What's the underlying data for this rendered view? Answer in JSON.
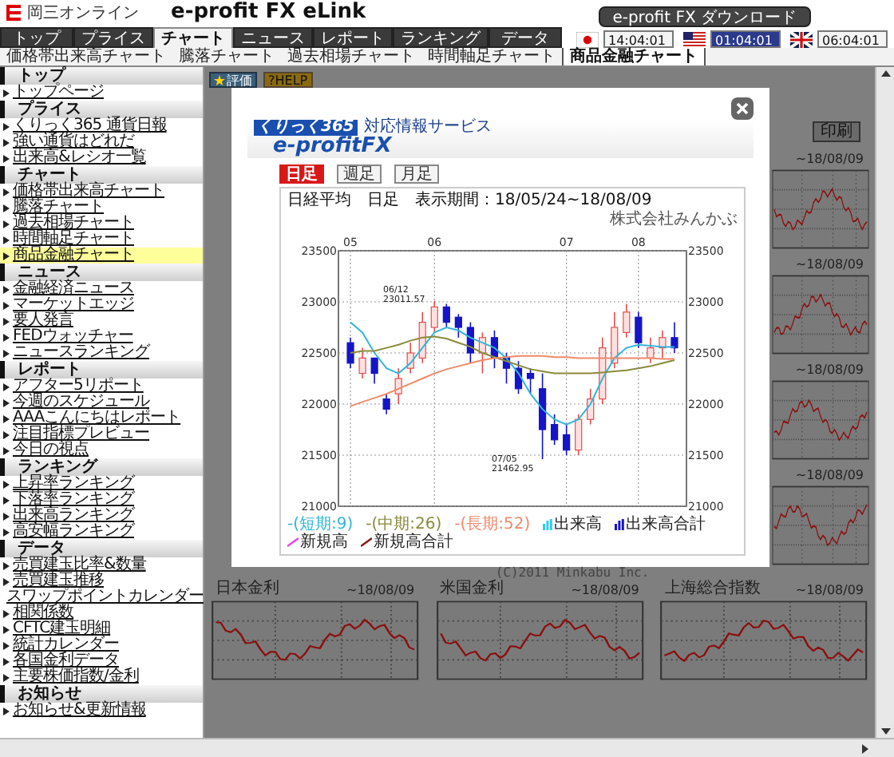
{
  "header": {
    "brand": "岡三オンライン",
    "product": "e-profit FX eLink",
    "download_button": "e-profit FX ダウンロード"
  },
  "nav": {
    "tabs": [
      {
        "label": "トップ",
        "selected": false
      },
      {
        "label": "プライス",
        "selected": false
      },
      {
        "label": "チャート",
        "selected": true
      },
      {
        "label": "ニュース",
        "selected": false
      },
      {
        "label": "レポート",
        "selected": false
      },
      {
        "label": "ランキング",
        "selected": false
      },
      {
        "label": "データ",
        "selected": false
      }
    ]
  },
  "clocks": [
    {
      "time": "14:04:01",
      "highlighted": false
    },
    {
      "time": "01:04:01",
      "highlighted": true
    },
    {
      "time": "06:04:01",
      "highlighted": false
    }
  ],
  "subtabs": [
    {
      "label": "価格帯出来高チャート",
      "selected": false
    },
    {
      "label": "騰落チャート",
      "selected": false
    },
    {
      "label": "過去相場チャート",
      "selected": false
    },
    {
      "label": "時間軸足チャート",
      "selected": false
    },
    {
      "label": "商品金融チャート",
      "selected": true
    }
  ],
  "sidebar": {
    "sections": [
      {
        "title": "トップ",
        "items": [
          {
            "label": "トップページ",
            "selected": false
          }
        ]
      },
      {
        "title": "プライス",
        "items": [
          {
            "label": "くりっく365 通貨日報",
            "selected": false
          },
          {
            "label": "強い通貨はどれだ",
            "selected": false
          },
          {
            "label": "出来高&レシオ一覧",
            "selected": false
          }
        ]
      },
      {
        "title": "チャート",
        "items": [
          {
            "label": "価格帯出来高チャート",
            "selected": false
          },
          {
            "label": "騰落チャート",
            "selected": false
          },
          {
            "label": "過去相場チャート",
            "selected": false
          },
          {
            "label": "時間軸足チャート",
            "selected": false
          },
          {
            "label": "商品金融チャート",
            "selected": true
          }
        ]
      },
      {
        "title": "ニュース",
        "items": [
          {
            "label": "金融経済ニュース",
            "selected": false
          },
          {
            "label": "マーケットエッジ",
            "selected": false
          },
          {
            "label": "要人発言",
            "selected": false
          },
          {
            "label": "FEDウォッチャー",
            "selected": false
          },
          {
            "label": "ニュースランキング",
            "selected": false
          }
        ]
      },
      {
        "title": "レポート",
        "items": [
          {
            "label": "アフター5リポート",
            "selected": false
          },
          {
            "label": "今週のスケジュール",
            "selected": false
          },
          {
            "label": "AAAこんにちはレポート",
            "selected": false
          },
          {
            "label": "注目指標プレビュー",
            "selected": false
          },
          {
            "label": "今日の視点",
            "selected": false
          }
        ]
      },
      {
        "title": "ランキング",
        "items": [
          {
            "label": "上昇率ランキング",
            "selected": false
          },
          {
            "label": "下落率ランキング",
            "selected": false
          },
          {
            "label": "出来高ランキング",
            "selected": false
          },
          {
            "label": "高安幅ランキング",
            "selected": false
          }
        ]
      },
      {
        "title": "データ",
        "items": [
          {
            "label": "売買建玉比率&数量",
            "selected": false
          },
          {
            "label": "売買建玉推移",
            "selected": false
          },
          {
            "label": "スワップポイントカレンダー",
            "selected": false
          },
          {
            "label": "相関係数",
            "selected": false
          },
          {
            "label": "CFTC建玉明細",
            "selected": false
          },
          {
            "label": "統計カレンダー",
            "selected": false
          },
          {
            "label": "各国金利データ",
            "selected": false
          },
          {
            "label": "主要株価指数/金利",
            "selected": false
          }
        ]
      },
      {
        "title": "お知らせ",
        "items": [
          {
            "label": "お知らせ&更新情報",
            "selected": false
          }
        ]
      }
    ]
  },
  "toolbar": {
    "buttons": [
      "評価",
      "?HELP"
    ]
  },
  "print_button": "印刷",
  "panels": {
    "right_column": [
      {
        "period": "~18/08/09"
      },
      {
        "period": "~18/08/09"
      },
      {
        "period": "~18/08/09"
      },
      {
        "period": "~18/08/09"
      }
    ],
    "bottom_row": [
      {
        "title": "日本金利",
        "period": "~18/08/09"
      },
      {
        "title": "米国金利",
        "period": "~18/08/09"
      },
      {
        "title": "上海総合指数",
        "period": "~18/08/09"
      }
    ]
  },
  "modal": {
    "logo": {
      "badge": "くりっく365",
      "tagline": "対応情報サービス",
      "name": "e-profitFX"
    },
    "tabs": [
      {
        "label": "日足",
        "selected": true
      },
      {
        "label": "週足",
        "selected": false
      },
      {
        "label": "月足",
        "selected": false
      }
    ],
    "chart_title": "日経平均　日足　表示期間：18/05/24~18/08/09",
    "provider": "株式会社みんかぶ",
    "copyright": "(C)2011 Minkabu Inc.",
    "right_axis_labels": [
      "23500",
      "23000",
      "22500",
      "22000",
      "21500",
      "21000"
    ],
    "chart_data": {
      "type": "candlestick",
      "grid": true,
      "categories": [
        "05",
        null,
        null,
        null,
        null,
        null,
        null,
        "06",
        null,
        null,
        null,
        null,
        null,
        null,
        null,
        null,
        null,
        null,
        "07",
        null,
        null,
        null,
        null,
        null,
        "08",
        null,
        null,
        null
      ],
      "ylim": [
        21000,
        23500
      ],
      "yticks": [
        {
          "value": 23500,
          "label": "23500"
        },
        {
          "value": 23000,
          "label": "23000"
        },
        {
          "value": 22500,
          "label": "22500"
        },
        {
          "value": 22000,
          "label": "22000"
        },
        {
          "value": 21500,
          "label": "21500"
        },
        {
          "value": 21000,
          "label": "21000"
        }
      ],
      "ohlc": [
        [
          22600,
          22650,
          22350,
          22400
        ],
        [
          22300,
          22550,
          22250,
          22450
        ],
        [
          22450,
          22450,
          22200,
          22300
        ],
        [
          22050,
          22100,
          21900,
          21950
        ],
        [
          22100,
          22350,
          22000,
          22250
        ],
        [
          22350,
          22600,
          22300,
          22500
        ],
        [
          22450,
          22900,
          22400,
          22800
        ],
        [
          22750,
          23010,
          22700,
          22950
        ],
        [
          22950,
          22980,
          22750,
          22800
        ],
        [
          22850,
          22880,
          22650,
          22750
        ],
        [
          22750,
          22800,
          22400,
          22500
        ],
        [
          22500,
          22700,
          22300,
          22650
        ],
        [
          22650,
          22720,
          22350,
          22450
        ],
        [
          22450,
          22500,
          22200,
          22350
        ],
        [
          22350,
          22420,
          22100,
          22150
        ],
        [
          22300,
          22350,
          22100,
          22250
        ],
        [
          22150,
          22300,
          21460,
          21750
        ],
        [
          21800,
          21900,
          21600,
          21650
        ],
        [
          21700,
          21800,
          21500,
          21550
        ],
        [
          21550,
          21900,
          21500,
          21850
        ],
        [
          21850,
          22150,
          21800,
          22050
        ],
        [
          22050,
          22650,
          22000,
          22550
        ],
        [
          22400,
          22900,
          22350,
          22750
        ],
        [
          22700,
          22980,
          22650,
          22900
        ],
        [
          22850,
          22900,
          22550,
          22600
        ],
        [
          22450,
          22650,
          22400,
          22550
        ],
        [
          22550,
          22720,
          22450,
          22650
        ],
        [
          22650,
          22800,
          22500,
          22550
        ]
      ],
      "series": [
        {
          "name": "-(短期:9)",
          "type": "line",
          "color": "#33b5d8",
          "values": [
            22800,
            22700,
            22500,
            22350,
            22300,
            22400,
            22550,
            22700,
            22750,
            22720,
            22650,
            22600,
            22550,
            22450,
            22300,
            22100,
            21950,
            21850,
            21800,
            21850,
            22000,
            22250,
            22450,
            22550,
            22580,
            22570,
            22560,
            22560
          ]
        },
        {
          "name": "-(中期:26)",
          "type": "line",
          "color": "#8a8a3c",
          "values": [
            22500,
            22520,
            22520,
            22550,
            22580,
            22620,
            22650,
            22660,
            22640,
            22600,
            22560,
            22500,
            22460,
            22420,
            22380,
            22340,
            22320,
            22300,
            22300,
            22300,
            22300,
            22310,
            22320,
            22330,
            22350,
            22370,
            22400,
            22430
          ]
        },
        {
          "name": "-(長期:52)",
          "type": "line",
          "color": "#f0896a",
          "values": [
            21980,
            22020,
            22060,
            22100,
            22150,
            22200,
            22250,
            22300,
            22340,
            22370,
            22400,
            22430,
            22450,
            22460,
            22470,
            22470,
            22470,
            22460,
            22460,
            22450,
            22450,
            22450,
            22450,
            22450,
            22450,
            22450,
            22440,
            22440
          ]
        }
      ],
      "annotations": [
        {
          "text": "06/12"
        },
        {
          "text": "23011.57"
        },
        {
          "text": "07/05"
        },
        {
          "text": "21462.95"
        }
      ]
    },
    "legend_extra": [
      {
        "label": "出来高",
        "color": "#33ccee",
        "kind": "bars"
      },
      {
        "label": "出来高合計",
        "color": "#1414c8",
        "kind": "bars"
      },
      {
        "label": "新規高",
        "color": "#ee44ee",
        "kind": "line"
      },
      {
        "label": "新規高合計",
        "color": "#8b1a1a",
        "kind": "line"
      }
    ]
  }
}
